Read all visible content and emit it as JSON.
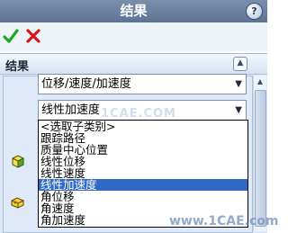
{
  "title": "结果",
  "help": "?",
  "toolbar": {
    "ok_icon": "checkmark-icon",
    "cancel_icon": "cross-icon"
  },
  "section": {
    "title": "结果",
    "collapse_icon": "double-chevron-up-icon"
  },
  "combo1": {
    "value": "位移/速度/加速度"
  },
  "combo2": {
    "value": "线性加速度"
  },
  "dropdown": {
    "options": [
      "<选取子类别>",
      "跟踪路径",
      "质量中心位置",
      "线性位移",
      "线性速度",
      "线性加速度",
      "角位移",
      "角速度",
      "角加速度"
    ],
    "selected_index": 5
  },
  "watermark_mid": "1CAE.COM",
  "watermark_bottom": "www.1CAE.com",
  "colors": {
    "titlebar": "#6a7fa1",
    "selected": "#3169c6",
    "ok": "#1fa71f",
    "cancel": "#d11a1a"
  }
}
